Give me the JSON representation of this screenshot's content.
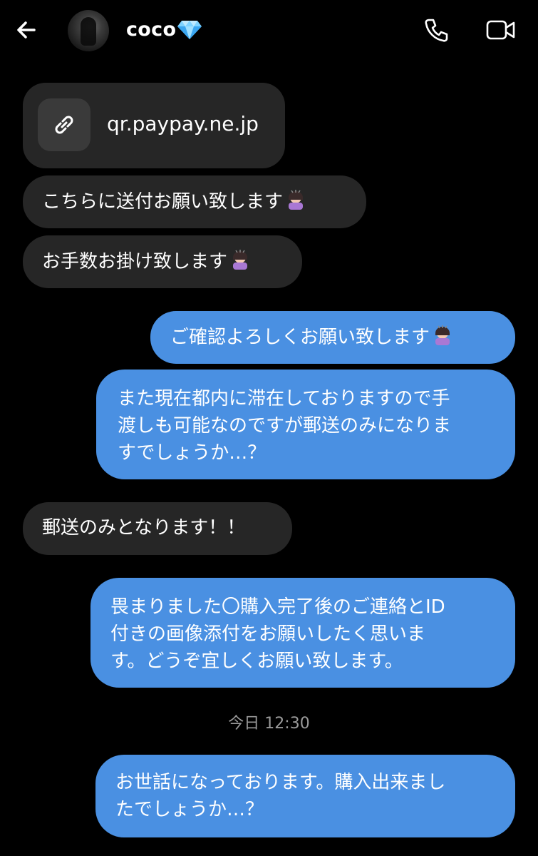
{
  "header": {
    "title": "coco",
    "back_icon": "back-arrow-icon",
    "badge_icon": "gem-icon",
    "phone_icon": "phone-icon",
    "video_icon": "video-camera-icon"
  },
  "messages": [
    {
      "kind": "link",
      "link_text": "qr.paypay.ne.jp",
      "icon": "link-icon"
    },
    {
      "kind": "in",
      "text": "こちらに送付お願い致します",
      "emoji": "bowing-person-emoji"
    },
    {
      "kind": "in",
      "text": "お手数お掛け致します",
      "emoji": "bowing-person-emoji"
    },
    {
      "kind": "out",
      "text": "ご確認よろしくお願い致します",
      "emoji": "bowing-person-emoji"
    },
    {
      "kind": "out",
      "lines": [
        "また現在都内に滞在しておりますので手",
        "渡しも可能なのですが郵送のみになりま",
        "すでしょうか…？"
      ]
    },
    {
      "kind": "in",
      "text": "郵送のみとなります！！"
    },
    {
      "kind": "out",
      "lines": [
        "畏まりました〇購入完了後のご連絡とID",
        "付きの画像添付をお願いしたく思いま",
        "す。どうぞ宜しくお願い致します。"
      ]
    },
    {
      "kind": "out",
      "lines": [
        "お世話になっております。購入出来まし",
        "たでしょうか…？"
      ]
    }
  ],
  "timestamp": "今日 12:30",
  "colors": {
    "background": "#000000",
    "incoming_bubble": "#262626",
    "outgoing_bubble": "#4a90e2",
    "timestamp": "#9a9a9a"
  }
}
